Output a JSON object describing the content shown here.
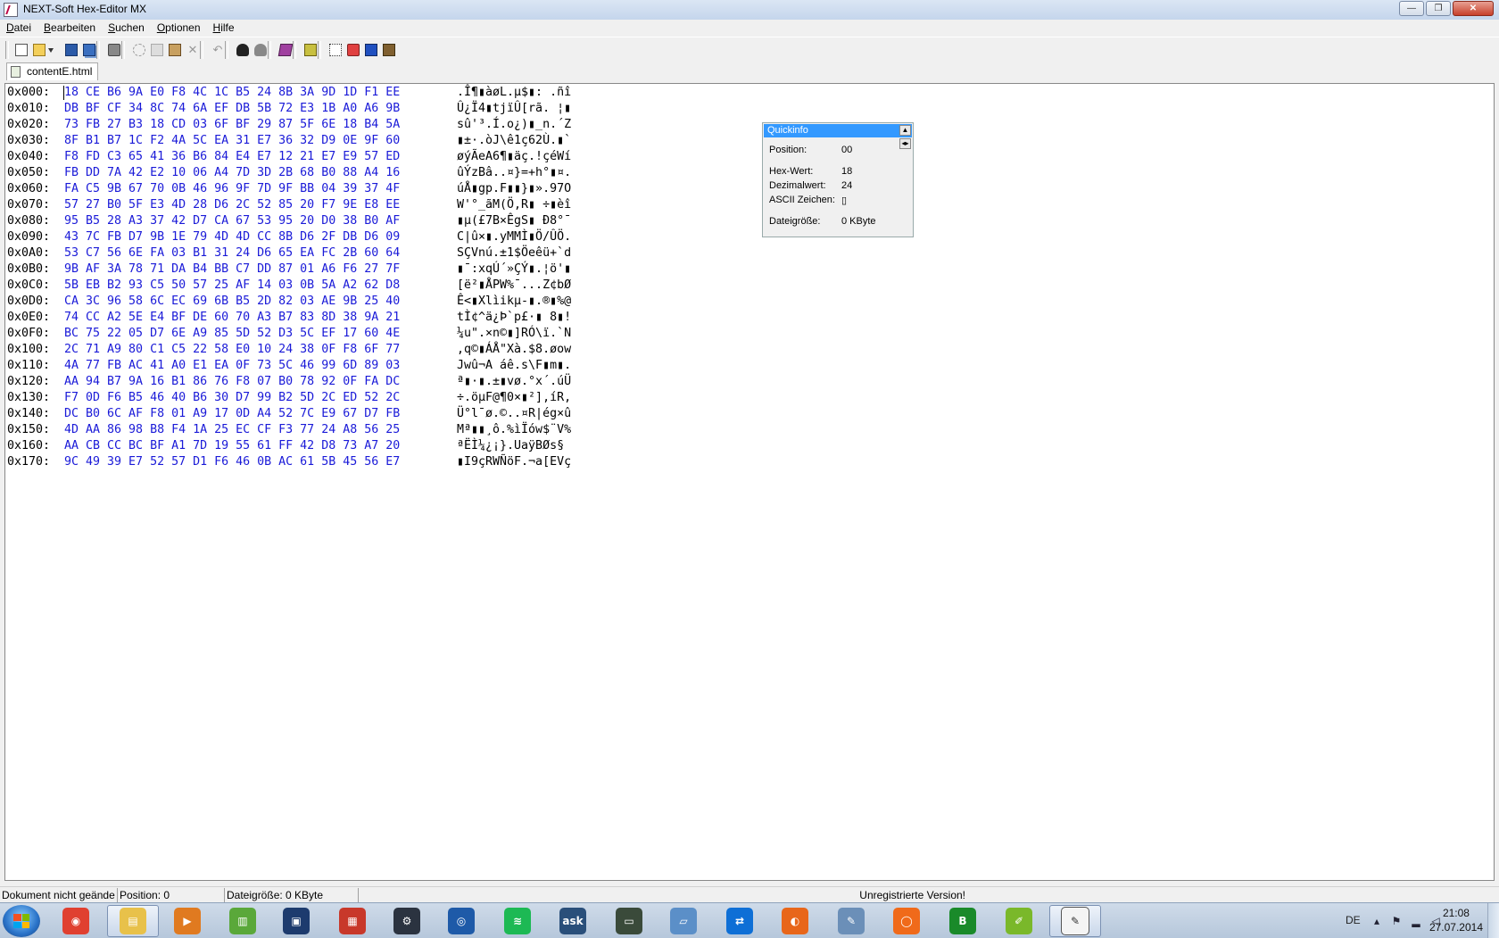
{
  "window": {
    "title": "NEXT-Soft Hex-Editor MX",
    "buttons": {
      "minimize": "—",
      "restore": "❐",
      "close": "✕"
    }
  },
  "menu": [
    {
      "label": "Datei",
      "accel": "D",
      "rest": "atei"
    },
    {
      "label": "Bearbeiten",
      "accel": "B",
      "rest": "earbeiten"
    },
    {
      "label": "Suchen",
      "accel": "S",
      "rest": "uchen"
    },
    {
      "label": "Optionen",
      "accel": "O",
      "rest": "ptionen"
    },
    {
      "label": "Hilfe",
      "accel": "H",
      "rest": "ilfe"
    }
  ],
  "toolbar_icons": [
    "new-file-icon",
    "open-file-icon",
    "open-dropdown-icon",
    "save-icon",
    "save-all-icon",
    "print-icon",
    "cut-icon",
    "copy-icon",
    "paste-icon",
    "delete-icon",
    "undo-icon",
    "find-icon",
    "find-next-icon",
    "bookmark-icon",
    "calculator-icon",
    "select-block-icon",
    "convert-icon",
    "export-icon",
    "compare-icon"
  ],
  "tab": {
    "label": "contentE.html"
  },
  "hex_rows": [
    {
      "off": "0x000:",
      "hex": "18 CE B6 9A E0 F8 4C 1C B5 24 8B 3A 9D 1D F1 EE",
      "asc": ".Î¶▮àøL.µ$▮: .ñî"
    },
    {
      "off": "0x010:",
      "hex": "DB BF CF 34 8C 74 6A EF DB 5B 72 E3 1B A0 A6 9B",
      "asc": "Û¿Ï4▮tjïÛ[rã. ¦▮"
    },
    {
      "off": "0x020:",
      "hex": "73 FB 27 B3 18 CD 03 6F BF 29 87 5F 6E 18 B4 5A",
      "asc": "sû'³.Í.o¿)▮_n.´Z"
    },
    {
      "off": "0x030:",
      "hex": "8F B1 B7 1C F2 4A 5C EA 31 E7 36 32 D9 0E 9F 60",
      "asc": "▮±·.òJ\\ê1ç62Ù.▮`"
    },
    {
      "off": "0x040:",
      "hex": "F8 FD C3 65 41 36 B6 84 E4 E7 12 21 E7 E9 57 ED",
      "asc": "øýÃeA6¶▮äç.!çéWí"
    },
    {
      "off": "0x050:",
      "hex": "FB DD 7A 42 E2 10 06 A4 7D 3D 2B 68 B0 88 A4 16",
      "asc": "ûÝzBâ..¤}=+h°▮¤."
    },
    {
      "off": "0x060:",
      "hex": "FA C5 9B 67 70 0B 46 96 9F 7D 9F BB 04 39 37 4F",
      "asc": "úÅ▮gp.F▮▮}▮».97O"
    },
    {
      "off": "0x070:",
      "hex": "57 27 B0 5F E3 4D 28 D6 2C 52 85 20 F7 9E E8 EE",
      "asc": "W'°_ãM(Ö,R▮ ÷▮èî"
    },
    {
      "off": "0x080:",
      "hex": "95 B5 28 A3 37 42 D7 CA 67 53 95 20 D0 38 B0 AF",
      "asc": "▮µ(£7B×ÊgS▮ Ð8°¯"
    },
    {
      "off": "0x090:",
      "hex": "43 7C FB D7 9B 1E 79 4D 4D CC 8B D6 2F DB D6 09",
      "asc": "C|û×▮.yMMÌ▮Ö/ÛÖ."
    },
    {
      "off": "0x0A0:",
      "hex": "53 C7 56 6E FA 03 B1 31 24 D6 65 EA FC 2B 60 64",
      "asc": "SÇVnú.±1$Öeêü+`d"
    },
    {
      "off": "0x0B0:",
      "hex": "9B AF 3A 78 71 DA B4 BB C7 DD 87 01 A6 F6 27 7F",
      "asc": "▮¯:xqÚ´»ÇÝ▮.¦ö'▮"
    },
    {
      "off": "0x0C0:",
      "hex": "5B EB B2 93 C5 50 57 25 AF 14 03 0B 5A A2 62 D8",
      "asc": "[ë²▮ÅPW%¯...Z¢bØ"
    },
    {
      "off": "0x0D0:",
      "hex": "CA 3C 96 58 6C EC 69 6B B5 2D 82 03 AE 9B 25 40",
      "asc": "Ê<▮Xlìikµ-▮.®▮%@"
    },
    {
      "off": "0x0E0:",
      "hex": "74 CC A2 5E E4 BF DE 60 70 A3 B7 83 8D 38 9A 21",
      "asc": "tÌ¢^ä¿Þ`p£·▮ 8▮!"
    },
    {
      "off": "0x0F0:",
      "hex": "BC 75 22 05 D7 6E A9 85 5D 52 D3 5C EF 17 60 4E",
      "asc": "¼u\".×n©▮]RÓ\\ï.`N"
    },
    {
      "off": "0x100:",
      "hex": "2C 71 A9 80 C1 C5 22 58 E0 10 24 38 0F F8 6F 77",
      "asc": ",q©▮ÁÅ\"Xà.$8.øow"
    },
    {
      "off": "0x110:",
      "hex": "4A 77 FB AC 41 A0 E1 EA 0F 73 5C 46 99 6D 89 03",
      "asc": "Jwû¬A áê.s\\F▮m▮."
    },
    {
      "off": "0x120:",
      "hex": "AA 94 B7 9A 16 B1 86 76 F8 07 B0 78 92 0F FA DC",
      "asc": "ª▮·▮.±▮vø.°x´.úÜ"
    },
    {
      "off": "0x130:",
      "hex": "F7 0D F6 B5 46 40 B6 30 D7 99 B2 5D 2C ED 52 2C",
      "asc": "÷.öµF@¶0×▮²],íR,"
    },
    {
      "off": "0x140:",
      "hex": "DC B0 6C AF F8 01 A9 17 0D A4 52 7C E9 67 D7 FB",
      "asc": "Ü°l¯ø.©..¤R|ég×û"
    },
    {
      "off": "0x150:",
      "hex": "4D AA 86 98 B8 F4 1A 25 EC CF F3 77 24 A8 56 25",
      "asc": "Mª▮▮¸ô.%ìÏów$¨V%"
    },
    {
      "off": "0x160:",
      "hex": "AA CB CC BC BF A1 7D 19 55 61 FF 42 D8 73 A7 20",
      "asc": "ªËÌ¼¿¡}.UaÿBØs§ "
    },
    {
      "off": "0x170:",
      "hex": "9C 49 39 E7 52 57 D1 F6 46 0B AC 61 5B 45 56 E7",
      "asc": "▮I9çRWÑöF.¬a[EVç"
    }
  ],
  "quickinfo": {
    "title": "Quickinfo",
    "position_label": "Position:",
    "position_value": "00",
    "hex_label": "Hex-Wert:",
    "hex_value": "18",
    "dec_label": "Dezimalwert:",
    "dec_value": "24",
    "ascii_label": "ASCII Zeichen:",
    "ascii_value": "▯",
    "size_label": "Dateigröße:",
    "size_value": "0 KByte"
  },
  "status": {
    "doc_state": "Dokument nicht geände",
    "position": "Position: 0",
    "filesize": "Dateigröße: 0 KByte",
    "license": "Unregistrierte Version!"
  },
  "taskbar": {
    "apps": [
      {
        "name": "chrome-icon",
        "color": "#e04030",
        "glyph": "◉"
      },
      {
        "name": "explorer-icon",
        "color": "#e8c14a",
        "glyph": "▤"
      },
      {
        "name": "media-player-icon",
        "color": "#e07a20",
        "glyph": "▶"
      },
      {
        "name": "network-monitor-icon",
        "color": "#5aa83a",
        "glyph": "▥"
      },
      {
        "name": "remote-desktop-icon",
        "color": "#1d3b6e",
        "glyph": "▣"
      },
      {
        "name": "pdf-icon",
        "color": "#c8382a",
        "glyph": "▦"
      },
      {
        "name": "steam-icon",
        "color": "#2b3340",
        "glyph": "⚙"
      },
      {
        "name": "messenger-icon",
        "color": "#1e5aa8",
        "glyph": "◎"
      },
      {
        "name": "spotify-icon",
        "color": "#1db954",
        "glyph": "≋"
      },
      {
        "name": "askfm-icon",
        "color": "#2a4f7a",
        "glyph": "ask"
      },
      {
        "name": "terminal-icon",
        "color": "#3a4a3a",
        "glyph": "▭"
      },
      {
        "name": "notepad-icon",
        "color": "#5b8fc8",
        "glyph": "▱"
      },
      {
        "name": "teamviewer-icon",
        "color": "#0e6fd6",
        "glyph": "⇄"
      },
      {
        "name": "firefox-icon",
        "color": "#e8661a",
        "glyph": "◐"
      },
      {
        "name": "cleaner-icon",
        "color": "#6b8fb8",
        "glyph": "✎"
      },
      {
        "name": "origin-icon",
        "color": "#f06a1a",
        "glyph": "◯"
      },
      {
        "name": "bandicam-icon",
        "color": "#1a8a2a",
        "glyph": "B"
      },
      {
        "name": "editor-icon",
        "color": "#7ab82a",
        "glyph": "✐"
      },
      {
        "name": "hex-editor-icon",
        "color": "#f4f4f4",
        "glyph": "✎"
      }
    ],
    "language": "DE",
    "time": "21:08",
    "date": "27.07.2014"
  }
}
